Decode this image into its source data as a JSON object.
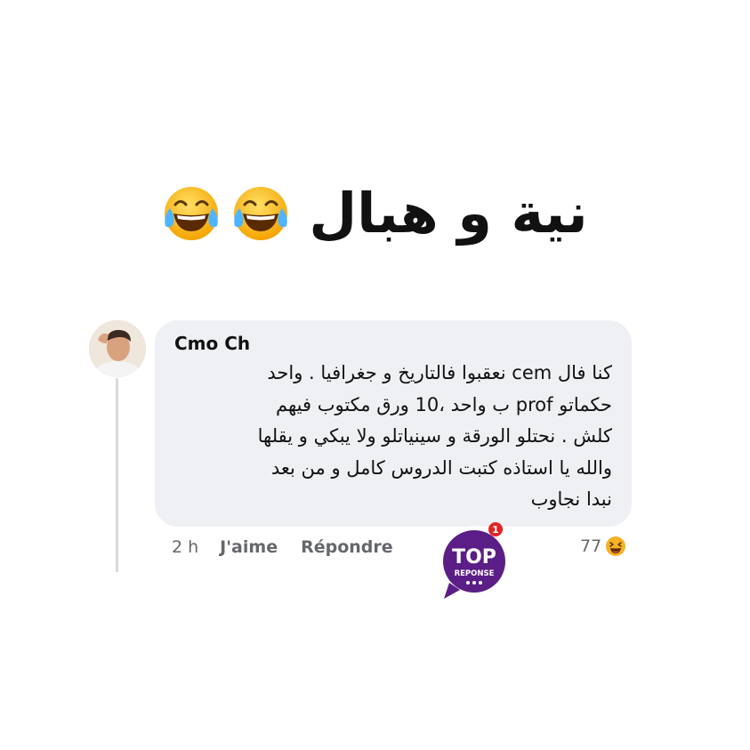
{
  "headline": {
    "text": "نية و هبال",
    "emoji": "face-with-tears-of-joy-icon"
  },
  "comment": {
    "author": "Cmo Ch",
    "lines": [
      "كنا فال cem نعقبوا فالتاريخ و جغرافيا . واحد",
      "حكماتو prof ب واحد ،10 ورق مكتوب فيهم",
      "كلش . نحتلو الورقة و سينياتلو ولا يبكي و يقلها",
      "والله يا استاذه كتبت الدروس كامل و من بعد",
      "نبدا نجاوب"
    ],
    "time": "2 h",
    "like_label": "J'aime",
    "reply_label": "Répondre",
    "reaction_count": "77",
    "reaction_icon": "laughing-face-icon"
  },
  "badge": {
    "top": "TOP",
    "sub": "REPONSE",
    "notification": "1"
  },
  "colors": {
    "bubble": "#eef0f3",
    "meta_text": "#65676b",
    "badge_purple": "#5b1e86",
    "notification_red": "#e02424"
  }
}
